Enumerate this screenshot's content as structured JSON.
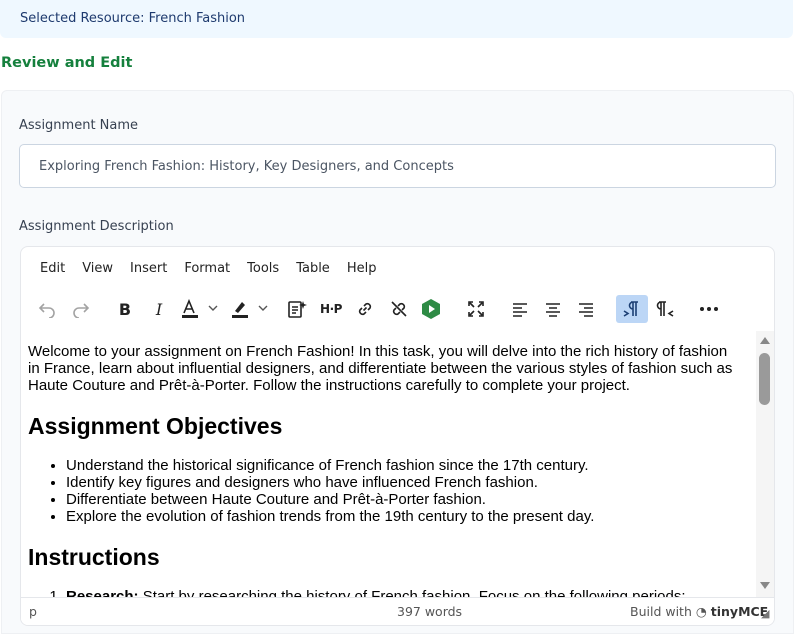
{
  "banner": {
    "text": "Selected Resource: French Fashion"
  },
  "section_title": "Review and Edit",
  "assignment_name": {
    "label": "Assignment Name",
    "value": "Exploring French Fashion: History, Key Designers, and Concepts"
  },
  "assignment_description": {
    "label": "Assignment Description",
    "menu": [
      "Edit",
      "View",
      "Insert",
      "Format",
      "Tools",
      "Table",
      "Help"
    ],
    "toolbar_icons": [
      "undo-icon",
      "redo-icon",
      "bold-icon",
      "italic-icon",
      "text-color-icon",
      "highlight-icon",
      "ai-assistant-icon",
      "h5p-icon",
      "link-icon",
      "unlink-icon",
      "media-icon",
      "fullscreen-icon",
      "align-left-icon",
      "align-center-icon",
      "align-right-icon",
      "ltr-icon",
      "rtl-icon",
      "more-icon"
    ],
    "content": {
      "intro": "Welcome to your assignment on French Fashion! In this task, you will delve into the rich history of fashion in France, learn about influential designers, and differentiate between the various styles of fashion such as Haute Couture and Prêt-à-Porter. Follow the instructions carefully to complete your project.",
      "heading_objectives": "Assignment Objectives",
      "objectives": [
        "Understand the historical significance of French fashion since the 17th century.",
        "Identify key figures and designers who have influenced French fashion.",
        "Differentiate between Haute Couture and Prêt-à-Porter fashion.",
        "Explore the evolution of fashion trends from the 19th century to the present day."
      ],
      "heading_instructions": "Instructions",
      "instructions": [
        {
          "bold": "Research:",
          "text": " Start by researching the history of French fashion. Focus on the following periods:"
        }
      ]
    },
    "status": {
      "path": "p",
      "word_count": "397 words",
      "brand_prefix": "Build with",
      "brand_name": "tinyMCE"
    }
  },
  "colors": {
    "banner_bg": "#eff8ff",
    "section_title": "#15803d",
    "active_button": "#bcd6f6"
  }
}
